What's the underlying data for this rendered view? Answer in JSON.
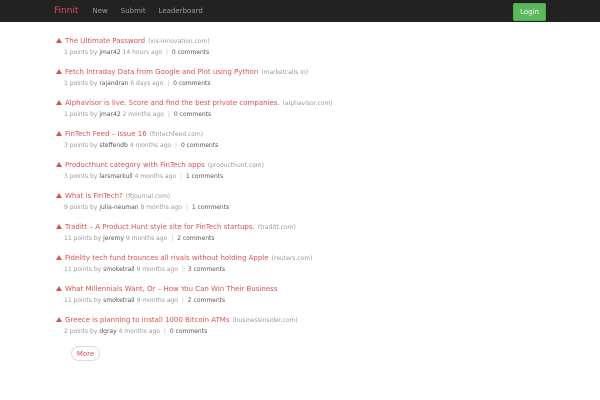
{
  "nav": {
    "brand": "Finnit",
    "links": [
      "New",
      "Submit",
      "Leaderboard"
    ],
    "login": "Login"
  },
  "posts": [
    {
      "title": "The Ultimate Password",
      "domain": "(xis-innovation.com)",
      "points": "1 points by",
      "user": "jmar42",
      "age": "14 hours ago",
      "comments": "0 comments"
    },
    {
      "title": "Fetch Intraday Data from Google and Plot using Python",
      "domain": "(marketcalls.in)",
      "points": "1 points by",
      "user": "rajandran",
      "age": "6 days ago",
      "comments": "0 comments"
    },
    {
      "title": "Alphavisor is live. Score and find the best private companies.",
      "domain": "(alphavisor.com)",
      "points": "1 points by",
      "user": "jmar42",
      "age": "2 months ago",
      "comments": "0 comments"
    },
    {
      "title": "FinTech Feed – Issue 16",
      "domain": "(fintechfeed.com)",
      "points": "3 points by",
      "user": "steffendb",
      "age": "4 months ago",
      "comments": "0 comments"
    },
    {
      "title": "Producthunt category with FinTech apps",
      "domain": "(producthunt.com)",
      "points": "3 points by",
      "user": "larsmarkull",
      "age": "4 months ago",
      "comments": "1 comments"
    },
    {
      "title": "What is FinTech?",
      "domain": "(ftjournal.com)",
      "points": "9 points by",
      "user": "julia-neuman",
      "age": "8 months ago",
      "comments": "1 comments"
    },
    {
      "title": "Traditt – A Product Hunt style site for FinTech startups.",
      "domain": "(traditt.com)",
      "points": "11 points by",
      "user": "jeremy",
      "age": "9 months ago",
      "comments": "2 comments"
    },
    {
      "title": "Fidelity tech fund trounces all rivals without holding Apple",
      "domain": "(reuters.com)",
      "points": "11 points by",
      "user": "smoketrail",
      "age": "9 months ago",
      "comments": "3 comments"
    },
    {
      "title": "What Millennials Want, Or – How You Can Win Their Business",
      "domain": "",
      "points": "11 points by",
      "user": "smoketrail",
      "age": "9 months ago",
      "comments": "2 comments"
    },
    {
      "title": "Greece is planning to install 1000 Bitcoin ATMs",
      "domain": "(businessinsider.com)",
      "points": "2 points by",
      "user": "dgray",
      "age": "4 months ago",
      "comments": "0 comments"
    }
  ],
  "more_label": "More",
  "colors": {
    "navbar": "#222222",
    "brand": "#e0485a",
    "link": "#d9534f",
    "login": "#5cb85c"
  }
}
